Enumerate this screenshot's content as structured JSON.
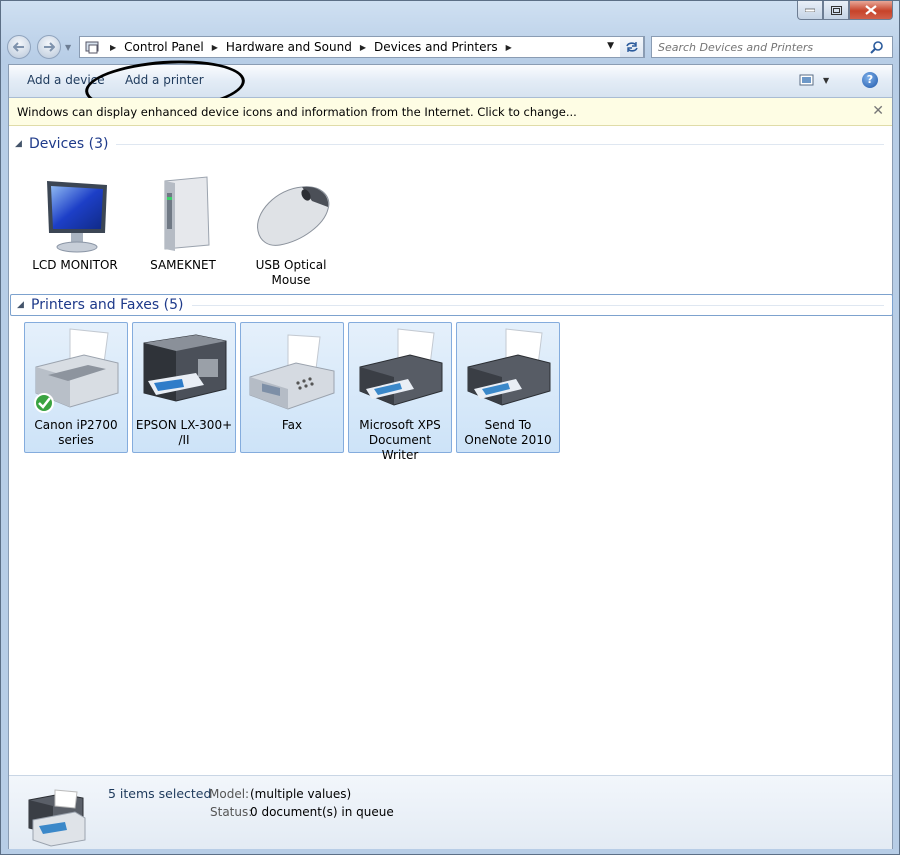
{
  "address": {
    "crumbs": [
      "Control Panel",
      "Hardware and Sound",
      "Devices and Printers"
    ]
  },
  "search": {
    "placeholder": "Search Devices and Printers"
  },
  "toolbar": {
    "add_device": "Add a device",
    "add_printer": "Add a printer"
  },
  "infobar": {
    "text": "Windows can display enhanced device icons and information from the Internet. Click to change...",
    "close": "✕"
  },
  "devices": {
    "title": "Devices (3)",
    "items": [
      {
        "label": "LCD MONITOR",
        "icon": "monitor-icon"
      },
      {
        "label": "SAMEKNET",
        "icon": "computer-tower-icon"
      },
      {
        "label": "USB Optical Mouse",
        "icon": "mouse-icon"
      }
    ]
  },
  "printers": {
    "title": "Printers and Faxes (5)",
    "items": [
      {
        "label": "Canon iP2700 series",
        "icon": "printer-icon",
        "default": true
      },
      {
        "label": "EPSON LX-300+ /II",
        "icon": "multifunction-printer-icon"
      },
      {
        "label": "Fax",
        "icon": "fax-icon"
      },
      {
        "label": "Microsoft XPS Document Writer",
        "icon": "printer-icon"
      },
      {
        "label": "Send To OneNote 2010",
        "icon": "printer-icon"
      }
    ]
  },
  "status": {
    "selected": "5 items selected",
    "model_label": "Model:",
    "model_value": "(multiple values)",
    "status_label": "Status:",
    "status_value": "0 document(s) in queue"
  }
}
